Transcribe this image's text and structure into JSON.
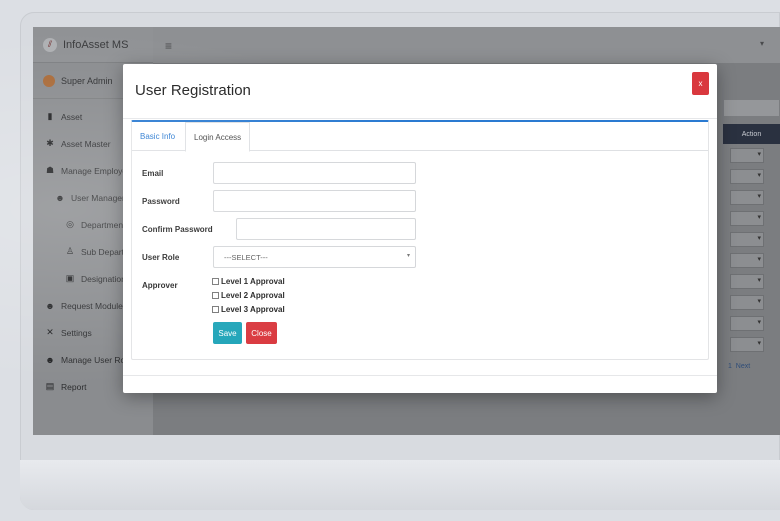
{
  "app": {
    "brand": "InfoAsset MS",
    "user_name": "Super Admin"
  },
  "sidebar": {
    "items": [
      {
        "label": "Asset",
        "icon": "briefcase-icon"
      },
      {
        "label": "Asset Master",
        "icon": "gear-icon"
      },
      {
        "label": "Manage Employee",
        "icon": "users-icon"
      },
      {
        "label": "User Management",
        "icon": "user-plus-icon"
      },
      {
        "label": "Department",
        "icon": "circle-gear-icon"
      },
      {
        "label": "Sub Department",
        "icon": "person-icon"
      },
      {
        "label": "Designation",
        "icon": "id-card-icon"
      },
      {
        "label": "Request Module",
        "icon": "user-plus-icon"
      },
      {
        "label": "Settings",
        "icon": "tools-icon"
      },
      {
        "label": "Manage User Role",
        "icon": "user-plus-icon"
      },
      {
        "label": "Report",
        "icon": "file-icon"
      }
    ]
  },
  "background_table": {
    "header": "Action",
    "next_label": "Next"
  },
  "modal": {
    "title": "User Registration",
    "close_label": "x",
    "tabs": [
      {
        "label": "Basic Info",
        "active": false
      },
      {
        "label": "Login Access",
        "active": true
      }
    ],
    "fields": {
      "email_label": "Email",
      "email_value": "",
      "password_label": "Password",
      "password_value": "",
      "confirm_label": "Confirm Password",
      "confirm_value": "",
      "role_label": "User Role",
      "role_selected": "---SELECT---",
      "approver_label": "Approver",
      "approvals": [
        "Level 1 Approval",
        "Level 2 Approval",
        "Level 3 Approval"
      ]
    },
    "buttons": {
      "save": "Save",
      "close": "Close"
    }
  },
  "colors": {
    "accent": "#2a7ad1",
    "save": "#1fa4b8",
    "danger": "#d9383e"
  }
}
